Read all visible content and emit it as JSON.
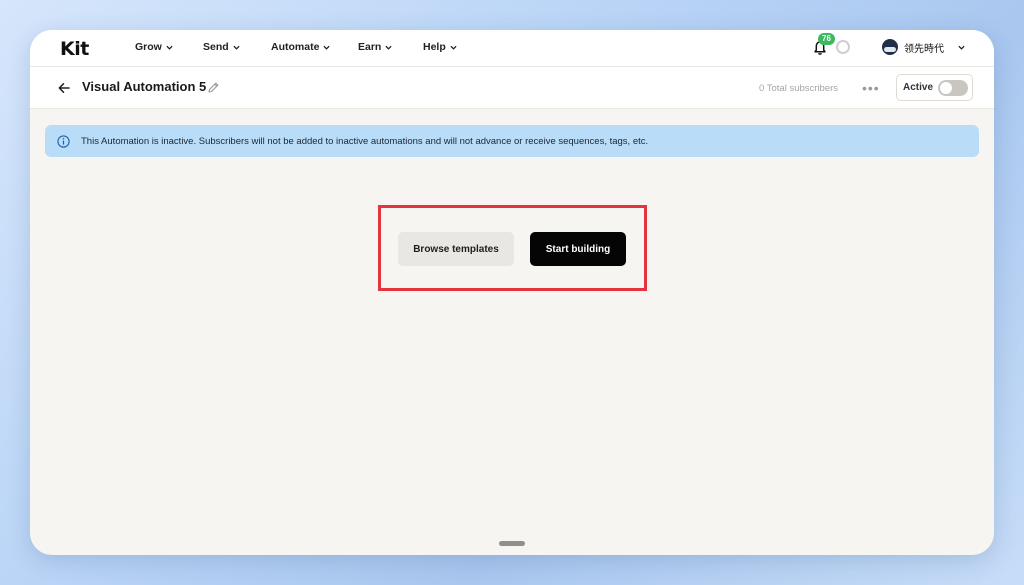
{
  "brand": {
    "logo_text": "Kit"
  },
  "nav": {
    "items": [
      {
        "label": "Grow"
      },
      {
        "label": "Send"
      },
      {
        "label": "Automate"
      },
      {
        "label": "Earn"
      },
      {
        "label": "Help"
      }
    ],
    "notifications_count": "76",
    "account_name": "领先時代"
  },
  "subheader": {
    "title": "Visual Automation 5",
    "subscribers_text": "0 Total subscribers",
    "more_label": "•••",
    "status_label": "Active",
    "status_on": false
  },
  "alert": {
    "message": "This Automation is inactive. Subscribers will not be added to inactive automations and will not advance or receive sequences, tags, etc."
  },
  "actions": {
    "browse_label": "Browse templates",
    "start_label": "Start building"
  },
  "colors": {
    "alert_bg": "#b9dcf8",
    "badge": "#3cb95e",
    "highlight": "#e6343f",
    "primary_button": "#050505"
  },
  "icons": [
    "chevron-down-icon",
    "bell-icon",
    "loading-icon",
    "avatar",
    "back-arrow-icon",
    "pencil-icon",
    "more-icon",
    "info-icon"
  ]
}
